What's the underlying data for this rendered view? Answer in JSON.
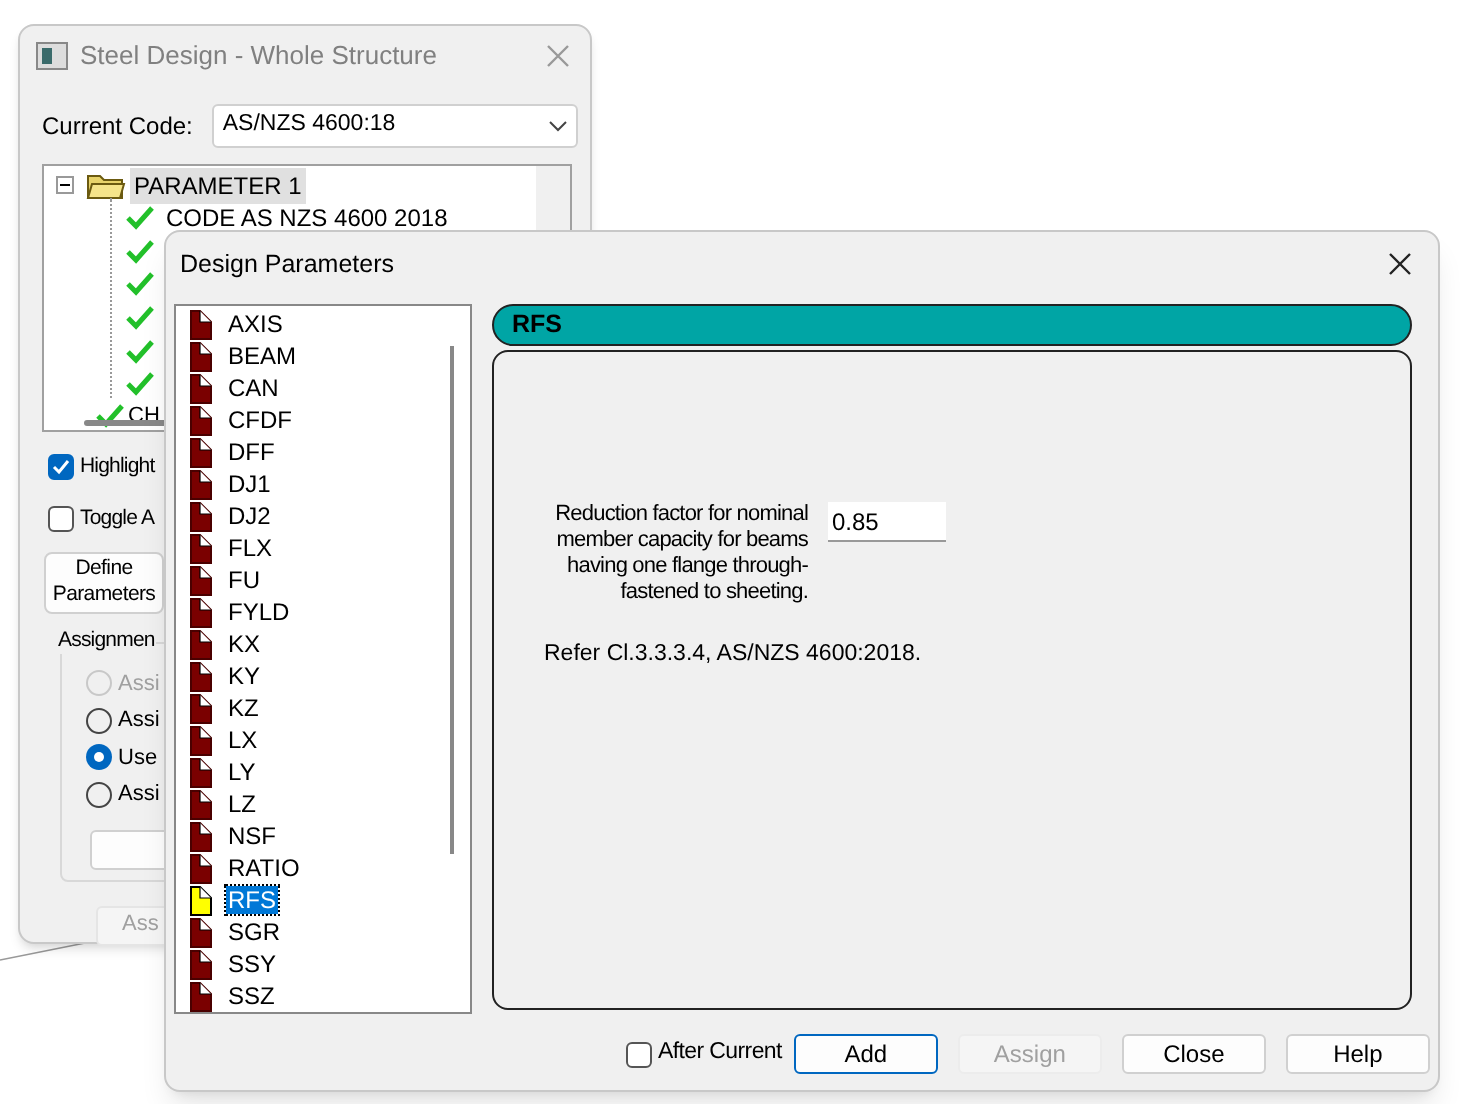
{
  "back_window": {
    "title": "Steel Design - Whole Structure",
    "current_code": {
      "label": "Current Code:",
      "value": "AS/NZS 4600:18"
    },
    "tree": [
      {
        "label": "PARAMETER 1",
        "selected": true,
        "expanded": true,
        "children": [
          {
            "checked": true,
            "label": "CODE AS NZS 4600 2018"
          },
          {
            "checked": true
          },
          {
            "checked": true
          },
          {
            "checked": true
          },
          {
            "checked": true
          },
          {
            "checked": true
          }
        ]
      },
      {
        "checked": true,
        "label": "CH"
      }
    ],
    "checkboxes": [
      {
        "label": "Highlight",
        "checked": true
      },
      {
        "label": "Toggle A",
        "checked": false
      }
    ],
    "define_button": "Define Parameters",
    "assignment": {
      "title": "Assignmen",
      "options": [
        {
          "label": "Assi",
          "selected": false,
          "disabled": true
        },
        {
          "label": "Assi",
          "selected": false,
          "disabled": false
        },
        {
          "label": "Use",
          "selected": true,
          "disabled": false
        },
        {
          "label": "Assi",
          "selected": false,
          "disabled": false
        }
      ]
    },
    "assign_button": {
      "label": "Ass",
      "disabled": true
    }
  },
  "front_window": {
    "title": "Design Parameters",
    "parameters": [
      {
        "label": "AXIS",
        "selected": false
      },
      {
        "label": "BEAM",
        "selected": false
      },
      {
        "label": "CAN",
        "selected": false
      },
      {
        "label": "CFDF",
        "selected": false
      },
      {
        "label": "DFF",
        "selected": false
      },
      {
        "label": "DJ1",
        "selected": false
      },
      {
        "label": "DJ2",
        "selected": false
      },
      {
        "label": "FLX",
        "selected": false
      },
      {
        "label": "FU",
        "selected": false
      },
      {
        "label": "FYLD",
        "selected": false
      },
      {
        "label": "KX",
        "selected": false
      },
      {
        "label": "KY",
        "selected": false
      },
      {
        "label": "KZ",
        "selected": false
      },
      {
        "label": "LX",
        "selected": false
      },
      {
        "label": "LY",
        "selected": false
      },
      {
        "label": "LZ",
        "selected": false
      },
      {
        "label": "NSF",
        "selected": false
      },
      {
        "label": "RATIO",
        "selected": false
      },
      {
        "label": "RFS",
        "selected": true
      },
      {
        "label": "SGR",
        "selected": false
      },
      {
        "label": "SSY",
        "selected": false
      },
      {
        "label": "SSZ",
        "selected": false
      }
    ],
    "panel": {
      "heading": "RFS",
      "field_label": "Reduction factor for nominal member capacity for beams having one flange through-fastened to sheeting.",
      "value": "0.85",
      "reference": "Refer Cl.3.3.3.4, AS/NZS 4600:2018."
    },
    "after_current": {
      "label": "After Current",
      "checked": false
    },
    "buttons": [
      {
        "label": "Add",
        "disabled": false,
        "default": true
      },
      {
        "label": "Assign",
        "disabled": true,
        "default": false
      },
      {
        "label": "Close",
        "disabled": false,
        "default": false
      },
      {
        "label": "Help",
        "disabled": false,
        "default": false
      }
    ]
  }
}
